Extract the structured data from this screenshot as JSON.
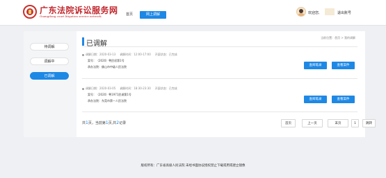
{
  "header": {
    "site_title": "广东法院诉讼服务网",
    "site_subtitle": "Guangdong court litigation service network",
    "nav": {
      "home": "首页",
      "mediation": "网上调解"
    },
    "welcome": "欢迎您,",
    "logout": "退出账号"
  },
  "sidebar": {
    "items": [
      {
        "label": "待调解"
      },
      {
        "label": "调解中"
      },
      {
        "label": "已调解"
      }
    ],
    "active_index": 2
  },
  "main": {
    "title": "已调解",
    "breadcrumb": "当前位置：首页 > 我的调解",
    "records": [
      {
        "mediation_date": "调解日期：2020-03-13",
        "mediation_time": "调解时间：12:00-17:00",
        "status": "开庭状态：已完成",
        "case_no": "案号：（2020）粤民初第1号",
        "court": "承办法院：佛山市中级人民法院",
        "btn_record": "查阅笔录",
        "btn_file": "查看案件"
      },
      {
        "mediation_date": "调解日期：2020-03-05",
        "mediation_time": "调解时间：18:30-23:30",
        "status": "开庭状态：已完成",
        "case_no": "案号：（2020）粤1971民调第1号",
        "court": "承办法院：东莞市第一人民法院",
        "btn_record": "查阅笔录",
        "btn_file": "查看案件"
      }
    ],
    "pager": {
      "pre1": "共",
      "total_pages": "1",
      "mid1": "页，当前第",
      "current_page": "1",
      "mid2": "页,共",
      "total_records": "2",
      "post": "记录",
      "first": "首页",
      "prev": "上一页",
      "next": "末页",
      "page_num": "1",
      "last": "跳转"
    }
  },
  "footer": "版权所有：广东省高级人民法院 未经书面协议授权禁止下载或用或建立镜像",
  "colors": {
    "accent": "#1e88e5",
    "brand_red": "#c1272d"
  },
  "icons": {
    "logo": "court-emblem-icon",
    "avatar": "user-avatar"
  }
}
